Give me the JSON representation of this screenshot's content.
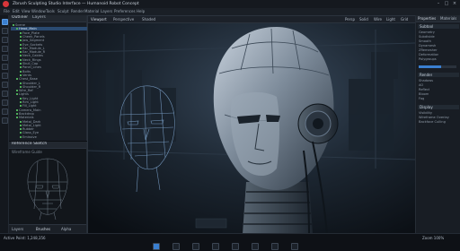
{
  "window": {
    "title": "Zbrush Sculpting Studio Interface — Humanoid Robot Concept",
    "minimize": "–",
    "maximize": "□",
    "close": "×"
  },
  "menu": {
    "items": [
      "File",
      "Edit",
      "View",
      "Window",
      "Tools",
      "Sculpt",
      "Render",
      "Material",
      "Layers",
      "Preferences",
      "Help"
    ]
  },
  "left_tools": {
    "icons": [
      "select-icon",
      "move-icon",
      "rotate-icon",
      "scale-icon",
      "brush-icon",
      "smooth-icon",
      "mask-icon",
      "knife-icon",
      "pen-icon",
      "camera-icon",
      "light-icon",
      "grid-icon"
    ]
  },
  "outliner": {
    "title": "Outliner",
    "tab2": "Layers",
    "rows": [
      {
        "label": "Scene",
        "level": 0
      },
      {
        "label": "Head_Main",
        "level": 1,
        "selected": true
      },
      {
        "label": "Face_Plate",
        "level": 2
      },
      {
        "label": "Cheek_Panels",
        "level": 2
      },
      {
        "label": "Jaw_Segment",
        "level": 2
      },
      {
        "label": "Eye_Sockets",
        "level": 2
      },
      {
        "label": "Ear_Module_L",
        "level": 2
      },
      {
        "label": "Ear_Module_R",
        "level": 2
      },
      {
        "label": "Neck_Cables",
        "level": 2
      },
      {
        "label": "Neck_Rings",
        "level": 2
      },
      {
        "label": "Skull_Cap",
        "level": 2
      },
      {
        "label": "Panel_Lines",
        "level": 2
      },
      {
        "label": "Bolts",
        "level": 2
      },
      {
        "label": "Vents",
        "level": 2
      },
      {
        "label": "Chest_Base",
        "level": 1
      },
      {
        "label": "Shoulder_L",
        "level": 2
      },
      {
        "label": "Shoulder_R",
        "level": 2
      },
      {
        "label": "Wire_Ref",
        "level": 1
      },
      {
        "label": "Lights",
        "level": 1
      },
      {
        "label": "Key_Light",
        "level": 2
      },
      {
        "label": "Rim_Light",
        "level": 2
      },
      {
        "label": "Fill_Light",
        "level": 2
      },
      {
        "label": "Camera_Main",
        "level": 1
      },
      {
        "label": "Backdrop",
        "level": 1
      },
      {
        "label": "Materials",
        "level": 1
      },
      {
        "label": "Metal_Dark",
        "level": 2
      },
      {
        "label": "Metal_Light",
        "level": 2
      },
      {
        "label": "Rubber",
        "level": 2
      },
      {
        "label": "Glass_Eye",
        "level": 2
      },
      {
        "label": "Emissive",
        "level": 2
      }
    ]
  },
  "reference": {
    "title": "Reference Sketch",
    "subtitle": "Wireframe Guide",
    "footer_tab1": "Layers",
    "footer_tab2": "Brushes",
    "footer_tab3": "Alpha"
  },
  "viewport": {
    "tab": "Viewport",
    "mode": "Perspective",
    "shading": "Shaded",
    "toolbar_items": [
      "Persp",
      "Solid",
      "Wire",
      "Light",
      "Grid"
    ]
  },
  "right_panel": {
    "tab1": "Properties",
    "tab2": "Materials",
    "section1": "Subtool",
    "rows1": [
      "Geometry",
      "Subdivide",
      "Smooth",
      "Dynamesh",
      "ZRemesher",
      "Deformation",
      "Polygroups"
    ],
    "section2": "Render",
    "rows2": [
      "Shadows",
      "AO",
      "Reflect",
      "Bloom",
      "Fog"
    ],
    "section3": "Display",
    "rows3": [
      "Visibility",
      "Wireframe Overlay",
      "Backface Culling"
    ]
  },
  "bottom_bar": {
    "left": "Active Point: 1,248,356",
    "right": "Zoom 100%",
    "icons": [
      "play-icon",
      "frame-icon",
      "camera-icon",
      "light-icon",
      "grid-icon",
      "axis-icon",
      "snap-icon",
      "record-icon"
    ]
  },
  "colors": {
    "accent": "#3a7fd0",
    "selection": "#2a4a70",
    "brand_red": "#d8363a",
    "panel": "#181d24",
    "background": "#0b0e12"
  }
}
